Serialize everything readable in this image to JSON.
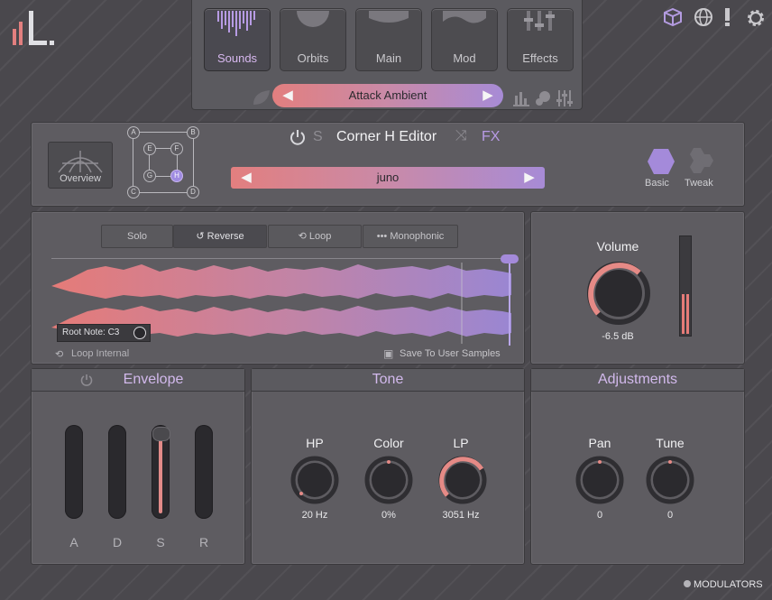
{
  "nav": {
    "tabs": [
      {
        "label": "Sounds",
        "active": true
      },
      {
        "label": "Orbits",
        "active": false
      },
      {
        "label": "Main",
        "active": false
      },
      {
        "label": "Mod",
        "active": false
      },
      {
        "label": "Effects",
        "active": false
      }
    ],
    "preset_name": "Attack Ambient"
  },
  "editor": {
    "power_icon": "power-icon",
    "solo_letter": "S",
    "title": "Corner H Editor",
    "fx_label": "FX",
    "overview_label": "Overview",
    "corners": [
      "A",
      "B",
      "C",
      "D"
    ],
    "inner": [
      "E",
      "F",
      "G",
      "H"
    ],
    "selected_node": "H",
    "sample_name": "juno",
    "view_basic": "Basic",
    "view_tweak": "Tweak"
  },
  "sample": {
    "modes": [
      "Solo",
      "Reverse",
      "Loop",
      "Monophonic"
    ],
    "active_mode": "Reverse",
    "root_note_label": "Root Note: C3",
    "loop_internal_label": "Loop Internal",
    "save_label": "Save To User Samples"
  },
  "volume": {
    "label": "Volume",
    "value": "-6.5 dB",
    "level": 0.7
  },
  "envelope": {
    "title": "Envelope",
    "sliders": [
      {
        "label": "A",
        "level": 0.0
      },
      {
        "label": "D",
        "level": 0.0
      },
      {
        "label": "S",
        "level": 0.88
      },
      {
        "label": "R",
        "level": 0.0
      }
    ]
  },
  "tone": {
    "title": "Tone",
    "knobs": [
      {
        "label": "HP",
        "value": "20 Hz",
        "level": 0.0
      },
      {
        "label": "Color",
        "value": "0%",
        "level": 0.5
      },
      {
        "label": "LP",
        "value": "3051 Hz",
        "level": 0.72
      }
    ]
  },
  "adjust": {
    "title": "Adjustments",
    "knobs": [
      {
        "label": "Pan",
        "value": "0",
        "level": 0.5
      },
      {
        "label": "Tune",
        "value": "0",
        "level": 0.5
      }
    ]
  },
  "footer": {
    "modulators_label": "MODULATORS"
  },
  "colors": {
    "accent": "#a78bd6",
    "coral": "#e27f7f",
    "panel": "#5e5c61"
  }
}
